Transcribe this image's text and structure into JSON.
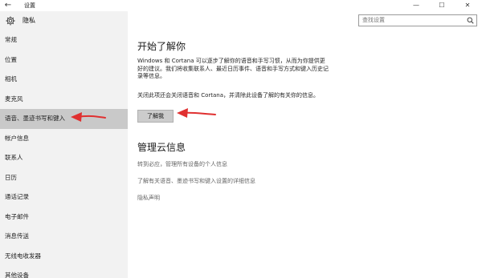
{
  "window": {
    "title": "设置",
    "back_glyph": "←",
    "minimize_glyph": "—",
    "maximize_glyph": "☐",
    "close_glyph": "✕"
  },
  "section": {
    "title": "隐私",
    "icon": "gear-icon"
  },
  "search": {
    "placeholder": "查找设置",
    "icon": "search-icon"
  },
  "sidebar": {
    "items": [
      {
        "label": "常规"
      },
      {
        "label": "位置"
      },
      {
        "label": "相机"
      },
      {
        "label": "麦克风"
      },
      {
        "label": "语音、墨迹书写和键入",
        "selected": true
      },
      {
        "label": "帐户信息"
      },
      {
        "label": "联系人"
      },
      {
        "label": "日历"
      },
      {
        "label": "通话记录"
      },
      {
        "label": "电子邮件"
      },
      {
        "label": "消息传送"
      },
      {
        "label": "无线电收发器"
      },
      {
        "label": "其他设备"
      }
    ]
  },
  "main": {
    "get_to_know": {
      "heading": "开始了解你",
      "paragraph1": "Windows 和 Cortana 可以逐步了解你的语音和手写习惯，从而为你提供更好的建议。我们将收集联系人、最近日历事件、语音和手写方式和键入历史记录等信息。",
      "paragraph2": "关闭此项还会关闭语音和 Cortana，并清除此设备了解的有关你的信息。",
      "button_label": "了解我"
    },
    "cloud": {
      "heading": "管理云信息",
      "links": [
        "转到必应，管理所有设备的个人信息",
        "了解有关语音、墨迹书写和键入设置的详细信息",
        "隐私声明"
      ]
    }
  },
  "colors": {
    "sidebar_bg": "#f2f2f2",
    "selected_bg": "#c9c9c9",
    "annotation_arrow": "#e03030",
    "link_gray": "#666666"
  }
}
